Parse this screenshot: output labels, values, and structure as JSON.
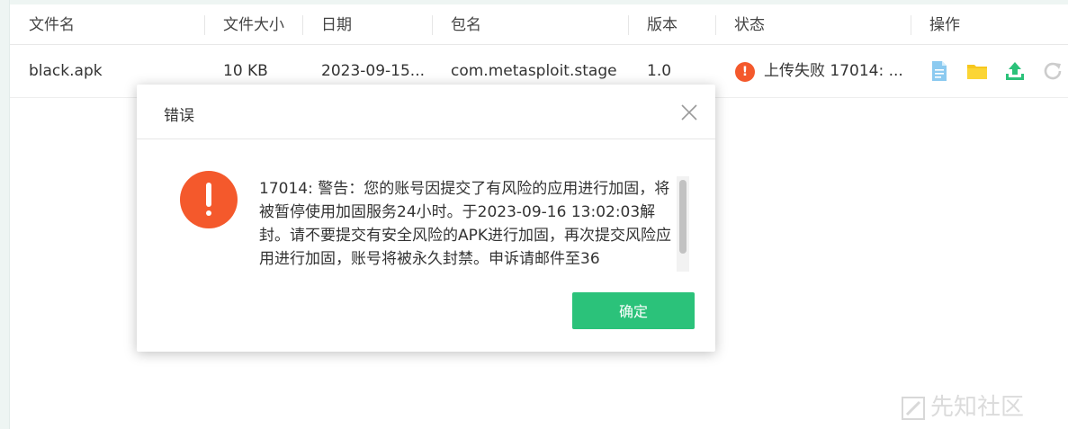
{
  "table": {
    "headers": {
      "name": "文件名",
      "size": "文件大小",
      "date": "日期",
      "package": "包名",
      "version": "版本",
      "status": "状态",
      "actions": "操作"
    },
    "rows": [
      {
        "name": "black.apk",
        "size": "10 KB",
        "date": "2023-09-15...",
        "package": "com.metasploit.stage",
        "version": "1.0",
        "status": "上传失败 17014: ...",
        "status_icon": "error-icon",
        "actions": [
          "file-icon",
          "folder-icon",
          "upload-icon",
          "refresh-icon"
        ]
      }
    ]
  },
  "dialog": {
    "title": "错误",
    "icon": "alert-icon",
    "message": "17014: 警告：您的账号因提交了有风险的应用进行加固，将被暂停使用加固服务24小时。于2023-09-16 13:02:03解封。请不要提交有安全风险的APK进行加固，再次提交风险应用进行加固，账号将被永久封禁。申诉请邮件至36",
    "confirm_label": "确定"
  },
  "watermark": {
    "text": "先知社区"
  },
  "colors": {
    "error": "#f4592c",
    "confirm": "#2bc27a",
    "file_icon": "#6fb8ea",
    "folder_icon": "#f7c71d",
    "upload_icon": "#2bc27a",
    "refresh_icon": "#c8c8c8"
  }
}
